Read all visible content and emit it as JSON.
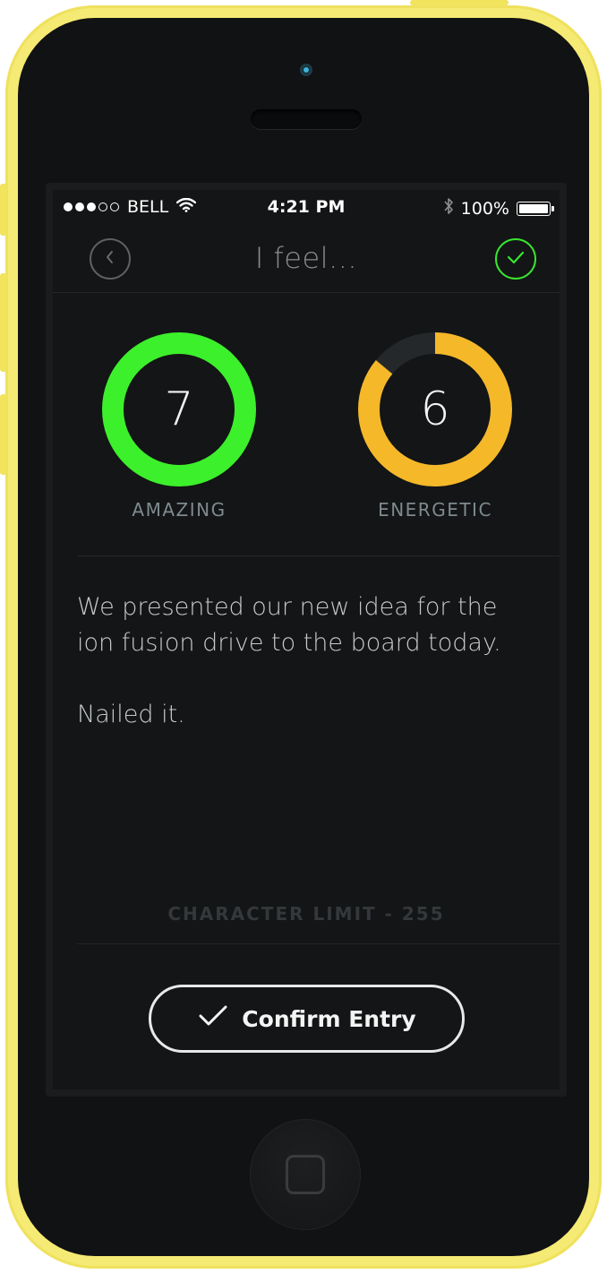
{
  "status_bar": {
    "carrier": "BELL",
    "time": "4:21 PM",
    "battery": "100%",
    "signal_strength": 3,
    "signal_max": 5
  },
  "nav": {
    "title": "I feel...",
    "back_icon": "chevron-left-icon",
    "done_icon": "checkmark-icon"
  },
  "gauges": [
    {
      "label": "AMAZING",
      "value": "7",
      "fill_fraction": 1.0,
      "color": "#3cf02b",
      "track_color": "#24282a"
    },
    {
      "label": "ENERGETIC",
      "value": "6",
      "fill_fraction": 0.86,
      "color": "#f5b829",
      "track_color": "#24282a"
    }
  ],
  "entry": {
    "line1": "We presented our new idea for the",
    "line2": "ion fusion drive to the board today.",
    "line3": "Nailed it."
  },
  "char_limit": "CHARACTER LIMIT - 255",
  "confirm_button": {
    "label": "Confirm Entry",
    "icon": "checkmark-icon"
  },
  "colors": {
    "device": "#f5ea74",
    "screen_bg": "#131516",
    "accent_green": "#3cf02b",
    "accent_orange": "#f5b829"
  }
}
